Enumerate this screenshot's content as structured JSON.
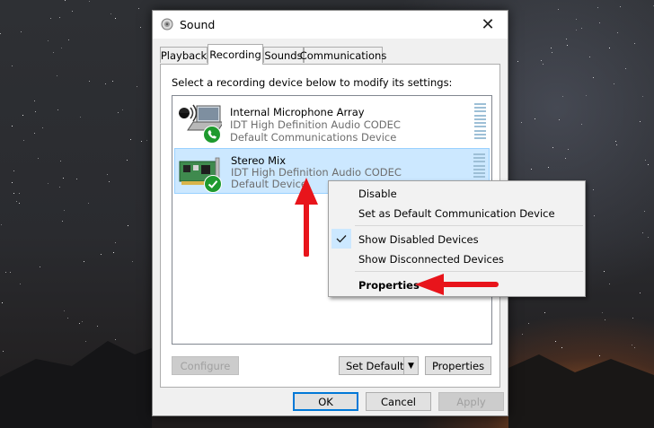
{
  "window": {
    "title": "Sound",
    "close_glyph": "✕",
    "title_icon": "speaker-icon"
  },
  "tabs": [
    {
      "label": "Playback",
      "active": false
    },
    {
      "label": "Recording",
      "active": true
    },
    {
      "label": "Sounds",
      "active": false
    },
    {
      "label": "Communications",
      "active": false
    }
  ],
  "instruction": "Select a recording device below to modify its settings:",
  "devices": [
    {
      "name": "Internal Microphone Array",
      "driver": "IDT High Definition Audio CODEC",
      "status": "Default Communications Device",
      "selected": false,
      "icon": "microphone-icon",
      "badge": "phone-icon"
    },
    {
      "name": "Stereo Mix",
      "driver": "IDT High Definition Audio CODEC",
      "status": "Default Device",
      "selected": true,
      "icon": "sound-card-icon",
      "badge": "check-icon"
    }
  ],
  "buttons": {
    "configure": "Configure",
    "set_default": "Set Default",
    "properties": "Properties",
    "ok": "OK",
    "cancel": "Cancel",
    "apply": "Apply"
  },
  "context_menu": {
    "items": [
      {
        "label": "Disable",
        "checked": false,
        "bold": false
      },
      {
        "label": "Set as Default Communication Device",
        "checked": false,
        "bold": false
      },
      {
        "label": "Show Disabled Devices",
        "checked": true,
        "bold": false
      },
      {
        "label": "Show Disconnected Devices",
        "checked": false,
        "bold": false
      },
      {
        "label": "Properties",
        "checked": false,
        "bold": true
      }
    ]
  },
  "colors": {
    "annotation_arrow": "#e8141b",
    "selection": "#cce8ff",
    "accent": "#0078d7"
  }
}
